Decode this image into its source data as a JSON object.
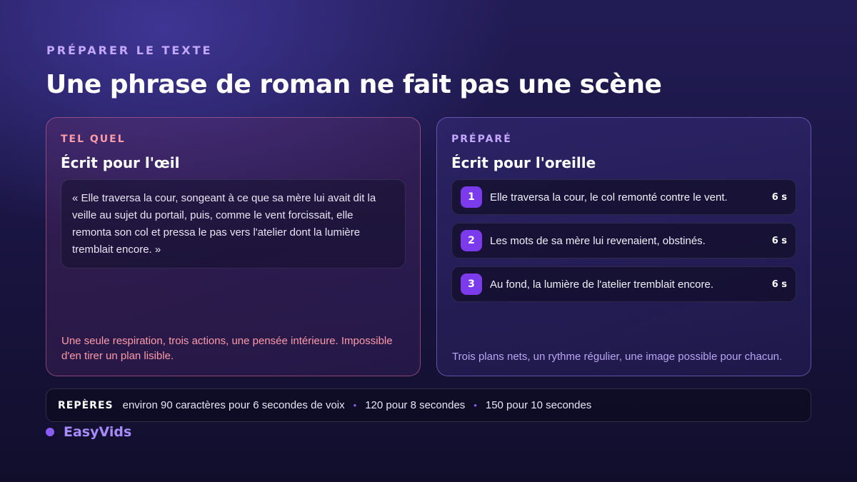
{
  "eyebrow": "PRÉPARER LE TEXTE",
  "title": "Une phrase de roman ne fait pas une scène",
  "left_card": {
    "tag": "TEL QUEL",
    "heading": "Écrit pour l'œil",
    "quote": "« Elle traversa la cour, songeant à ce que sa mère lui avait dit la veille au sujet du portail, puis, comme le vent forcissait, elle remonta son col et pressa le pas vers l'atelier dont la lumière tremblait encore. »",
    "footer": "Une seule respiration, trois actions, une pensée intérieure. Impossible d'en tirer un plan lisible."
  },
  "right_card": {
    "tag": "PRÉPARÉ",
    "heading": "Écrit pour l'oreille",
    "plans": [
      {
        "number": "1",
        "text": "Elle traversa la cour, le col remonté contre le vent.",
        "duration": "6 s"
      },
      {
        "number": "2",
        "text": "Les mots de sa mère lui revenaient, obstinés.",
        "duration": "6 s"
      },
      {
        "number": "3",
        "text": "Au fond, la lumière de l'atelier tremblait encore.",
        "duration": "6 s"
      }
    ],
    "footer": "Trois plans nets, un rythme régulier, une image possible pour chacun."
  },
  "reperes": {
    "label": "REPÈRES",
    "items": [
      "environ 90 caractères pour 6 secondes de voix",
      "120 pour 8 secondes",
      "150 pour 10 secondes"
    ],
    "separator": "•"
  },
  "brand": {
    "name": "EasyVids"
  },
  "colors": {
    "accent": "#7c3aed",
    "left_accent": "#ff9aa8",
    "right_accent": "#c4a8ff",
    "brand": "#a78bfa"
  }
}
